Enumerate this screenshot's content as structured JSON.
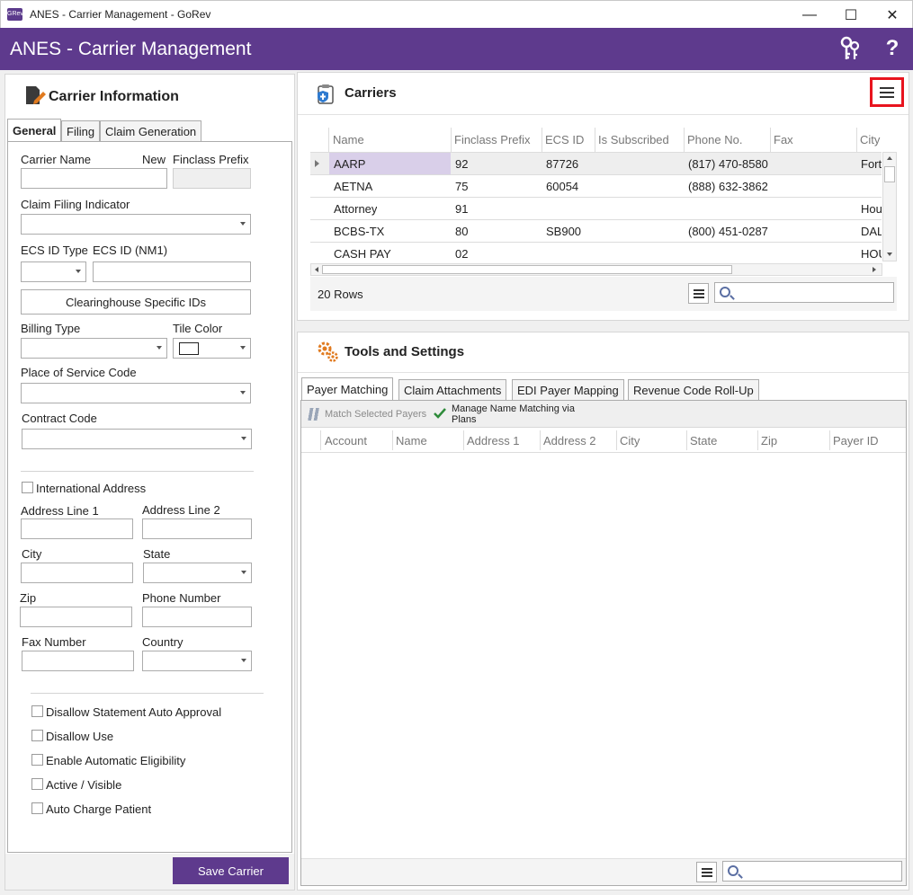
{
  "window": {
    "title": "ANES - Carrier Management - GoRev",
    "app_icon_text": "GRev",
    "minimize": "—",
    "maximize": "☐",
    "close": "✕"
  },
  "header": {
    "title": "ANES - Carrier Management",
    "help": "?"
  },
  "carrier_info": {
    "title": "Carrier Information",
    "tabs": [
      "General",
      "Filing",
      "Claim Generation"
    ],
    "labels": {
      "carrier_name": "Carrier Name",
      "new": "New",
      "finclass_prefix": "Finclass Prefix",
      "claim_filing_indicator": "Claim Filing Indicator",
      "ecs_id_type": "ECS ID Type",
      "ecs_id_nm1": "ECS ID (NM1)",
      "billing_type": "Billing Type",
      "tile_color": "Tile Color",
      "place_of_service_code": "Place of Service Code",
      "contract_code": "Contract Code",
      "international_address": "International Address",
      "address_line_1": "Address Line 1",
      "address_line_2": "Address Line 2",
      "city": "City",
      "state": "State",
      "zip": "Zip",
      "phone_number": "Phone Number",
      "fax_number": "Fax Number",
      "country": "Country"
    },
    "clearinghouse_button": "Clearinghouse Specific IDs",
    "checkboxes": [
      "Disallow Statement Auto Approval",
      "Disallow Use",
      "Enable Automatic Eligibility",
      "Active / Visible",
      "Auto Charge Patient"
    ],
    "save_button": "Save Carrier"
  },
  "carriers": {
    "title": "Carriers",
    "columns": [
      "Name",
      "Finclass Prefix",
      "ECS ID",
      "Is Subscribed",
      "Phone No.",
      "Fax",
      "City"
    ],
    "rows": [
      [
        "AARP",
        "92",
        "87726",
        "",
        "(817) 470-8580",
        "",
        "Fort"
      ],
      [
        "AETNA",
        "75",
        "60054",
        "",
        "(888) 632-3862",
        "",
        ""
      ],
      [
        "Attorney",
        "91",
        "",
        "",
        "",
        "",
        "Hou"
      ],
      [
        "BCBS-TX",
        "80",
        "SB900",
        "",
        "(800) 451-0287",
        "",
        "DAL"
      ],
      [
        "CASH PAY",
        "02",
        "",
        "",
        "",
        "",
        "HOU"
      ]
    ],
    "row_count": "20 Rows"
  },
  "tools": {
    "title": "Tools and Settings",
    "tabs": [
      "Payer Matching",
      "Claim Attachments",
      "EDI Payer Mapping",
      "Revenue Code Roll-Up"
    ],
    "toolbar": {
      "match_selected": "Match Selected Payers",
      "manage_name_matching": "Manage Name Matching via Plans"
    },
    "columns": [
      "Account",
      "Name",
      "Address 1",
      "Address 2",
      "City",
      "State",
      "Zip",
      "Payer ID"
    ]
  },
  "colors": {
    "brand_purple": "#5e3a8d",
    "selected_row": "#d9cfe9",
    "highlight_red": "#e8141e"
  }
}
